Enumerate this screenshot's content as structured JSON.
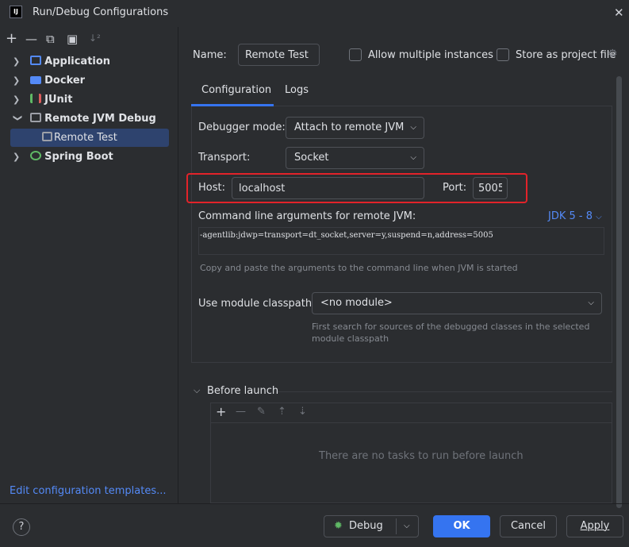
{
  "window": {
    "title": "Run/Debug Configurations",
    "logo_text": "IJ"
  },
  "left_toolbar": {
    "add": "+",
    "remove": "—",
    "copy": "⧉",
    "folder": "▣",
    "sort": "↓²"
  },
  "tree": {
    "items": [
      {
        "label": "Application",
        "icon": "application-icon",
        "color": "#548af7"
      },
      {
        "label": "Docker",
        "icon": "docker-icon",
        "color": "#548af7"
      },
      {
        "label": "JUnit",
        "icon": "junit-icon",
        "color": "#db5c5c"
      },
      {
        "label": "Remote JVM Debug",
        "icon": "remote-debug-icon",
        "color": "#9da0a8"
      },
      {
        "label": "Spring Boot",
        "icon": "spring-boot-icon",
        "color": "#5fb865"
      }
    ],
    "child": {
      "label": "Remote Test",
      "icon": "remote-config-icon"
    }
  },
  "edit_templates": "Edit configuration templates...",
  "name_row": {
    "name_label": "Name:",
    "name_value": "Remote Test",
    "allow_multiple": "Allow multiple instances",
    "store_as_project": "Store as project file"
  },
  "tabs": {
    "configuration": "Configuration",
    "logs": "Logs"
  },
  "config": {
    "debugger_mode_label": "Debugger mode:",
    "debugger_mode_value": "Attach to remote JVM",
    "transport_label": "Transport:",
    "transport_value": "Socket",
    "host_label": "Host:",
    "host_value": "localhost",
    "port_label": "Port:",
    "port_value": "5005",
    "cmd_label": "Command line arguments for remote JVM:",
    "jdk_select": "JDK 5 - 8",
    "cmd_value": "-agentlib:jdwp=transport=dt_socket,server=y,suspend=n,address=5005",
    "cmd_hint": "Copy and paste the arguments to the command line when JVM is started",
    "module_label": "Use module classpath:",
    "module_value": "<no module>",
    "module_hint_1": "First search for sources of the debugged classes in the selected",
    "module_hint_2": "module classpath"
  },
  "before_launch": {
    "label": "Before launch",
    "empty_text": "There are no tasks to run before launch"
  },
  "buttons": {
    "help": "?",
    "debug": "Debug",
    "ok": "OK",
    "cancel": "Cancel",
    "apply": "Apply"
  },
  "colors": {
    "accent": "#3574f0",
    "highlight_border": "#e2232a",
    "link": "#548af7"
  }
}
